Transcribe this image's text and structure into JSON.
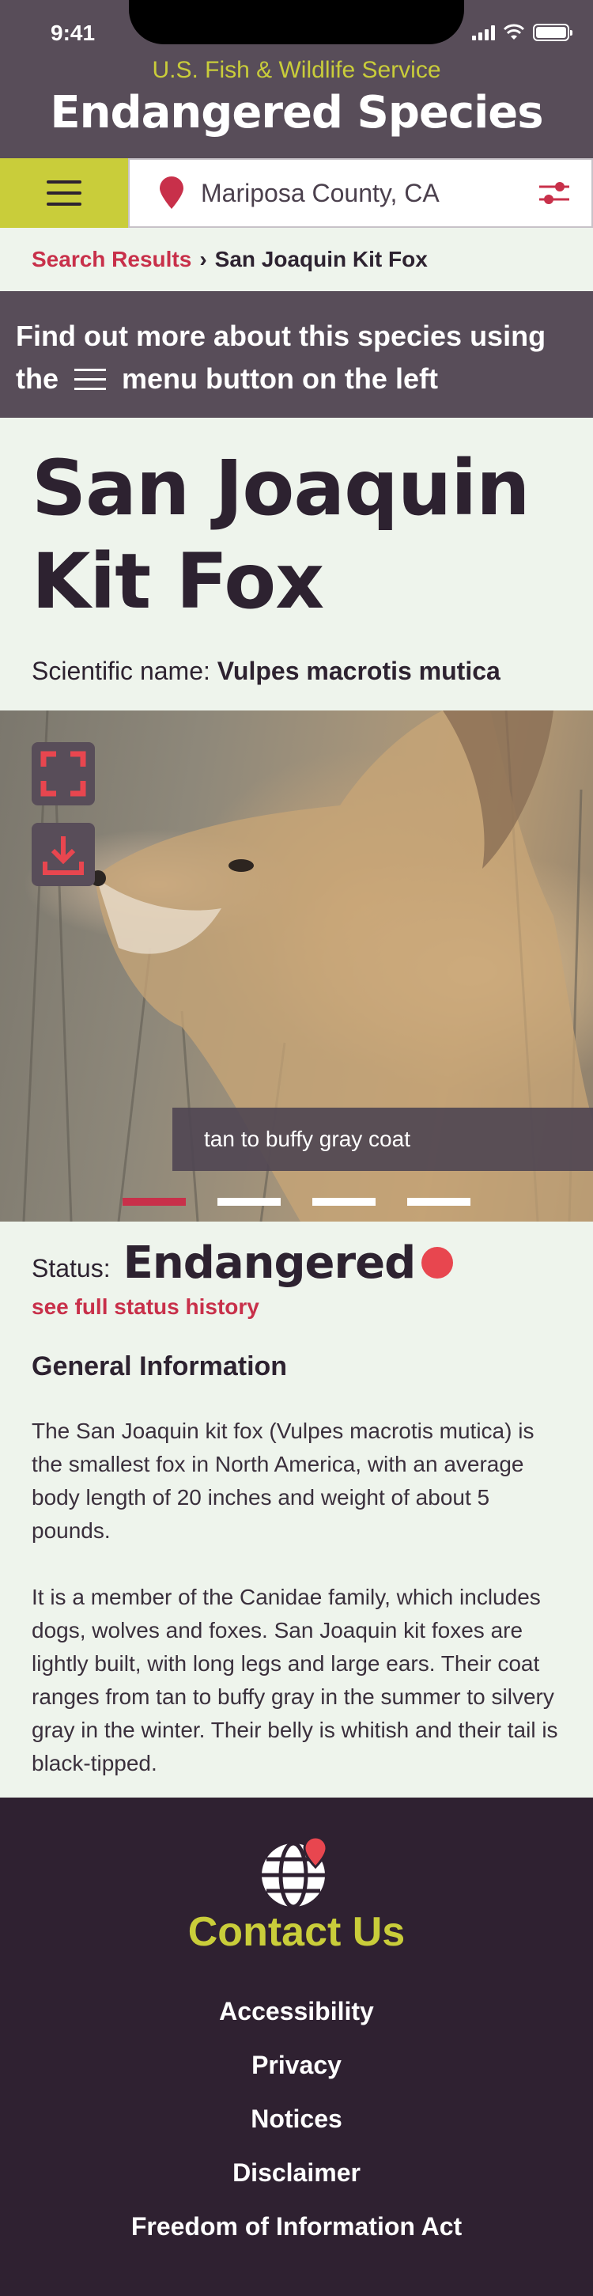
{
  "status_bar": {
    "time": "9:41"
  },
  "header": {
    "agency": "U.S. Fish & Wildlife Service",
    "title": "Endangered Species"
  },
  "search": {
    "location": "Mariposa County, CA"
  },
  "breadcrumb": {
    "link": "Search Results",
    "separator": "›",
    "current": "San Joaquin Kit Fox"
  },
  "hint": {
    "line1": "Find out more about this species using",
    "line2_prefix": "the",
    "line2_suffix": "menu button on the left"
  },
  "species": {
    "name": "San Joaquin Kit Fox",
    "sci_label": "Scientific name:",
    "sci_name": "Vulpes macrotis mutica"
  },
  "carousel": {
    "caption": "tan to buffy gray coat",
    "slide_count": 4,
    "active_slide": 1,
    "icons": [
      "fullscreen-icon",
      "download-icon"
    ]
  },
  "status": {
    "label": "Status:",
    "value": "Endangered",
    "history_link": "see full status history",
    "color": "#e8464f"
  },
  "general": {
    "heading": "General Information",
    "paragraphs": [
      "The San Joaquin kit fox (Vulpes macrotis mutica) is the smallest fox in North America, with an average body length of 20 inches and weight of about 5 pounds.",
      "It is a member of the Canidae family, which includes dogs, wolves and foxes. San Joaquin kit foxes are lightly built, with long legs and large ears. Their coat ranges from tan to buffy gray in the summer to silvery gray in the winter. Their belly is whitish and their tail is black-tipped."
    ]
  },
  "footer": {
    "contact": "Contact Us",
    "links": [
      "Accessibility",
      "Privacy",
      "Notices",
      "Disclaimer",
      "Freedom of Information Act"
    ]
  },
  "colors": {
    "header_bg": "#584d59",
    "accent": "#c9cd3a",
    "link": "#c8304a",
    "footer_bg": "#2f2131"
  }
}
